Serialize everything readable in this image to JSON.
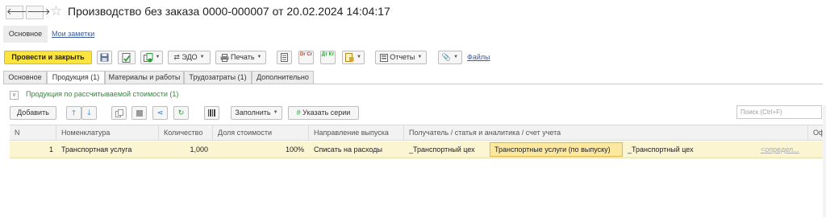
{
  "window": {
    "title": "Производство без заказа 0000-000007 от 20.02.2024 14:04:17",
    "back_glyph": "🡐",
    "forward_glyph": "🡒",
    "star_glyph": "☆"
  },
  "sections": {
    "main_label": "Основное",
    "notes_label": "Мои заметки"
  },
  "toolbar": {
    "post_close_label": "Провести и закрыть",
    "edo_label": "ЭДО",
    "print_label": "Печать",
    "dtkt_label": "Дт Кт",
    "dt_label": "Dr Cr",
    "reports_label": "Отчеты",
    "files_label": "Файлы",
    "caret": "▼"
  },
  "tabs": [
    {
      "label": "Основное"
    },
    {
      "label": "Продукция (1)"
    },
    {
      "label": "Материалы и работы"
    },
    {
      "label": "Трудозатраты (1)"
    },
    {
      "label": "Дополнительно"
    }
  ],
  "group": {
    "toggle": "v",
    "title": "Продукция по рассчитываемой стоимости (1)"
  },
  "table_toolbar": {
    "add_label": "Добавить",
    "fill_label": "Заполнить",
    "series_label": "Указать серии",
    "search_placeholder": "Поиск (Ctrl+F)"
  },
  "table": {
    "columns": [
      "N",
      "Номенклатура",
      "Количество",
      "Доля стоимости",
      "Направление выпуска",
      "Получатель / статья и аналитика / счет учета",
      "Офор"
    ],
    "rows": [
      {
        "n": "1",
        "item": "Транспортная услуга",
        "qty": "1,000",
        "share": "100%",
        "direction": "Списать на расходы",
        "recipient": "_Транспортный цех",
        "article": "Транспортные услуги (по выпуску)",
        "analytics": "_Транспортный цех",
        "account_hint": "<определ..."
      }
    ]
  },
  "colors": {
    "primary": "#fbe340",
    "selected_row": "#fbf5d1",
    "link": "#3d5a9a",
    "group_title": "#2f8a3a"
  }
}
